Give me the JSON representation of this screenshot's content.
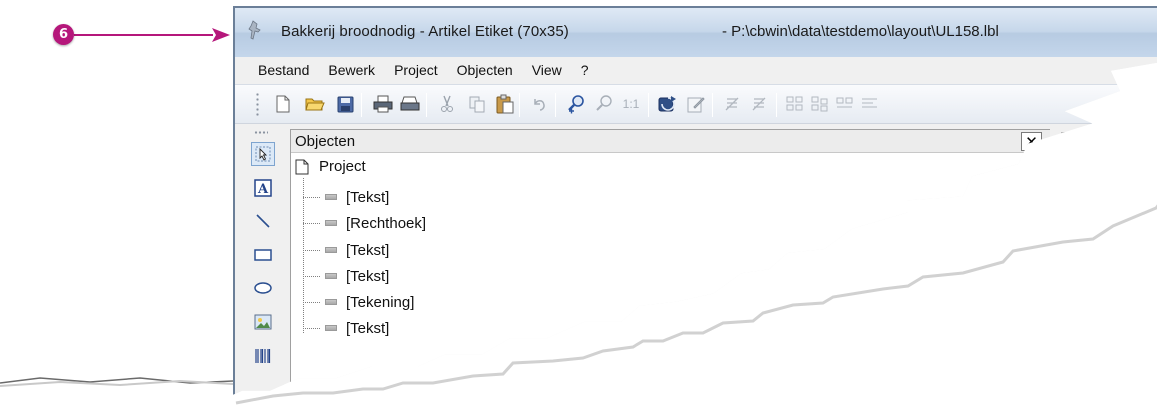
{
  "callout": {
    "number": "6",
    "color": "#b5177b"
  },
  "window": {
    "title": "Bakkerij broodnodig - Artikel Etiket (70x35)",
    "path": "- P:\\cbwin\\data\\testdemo\\layout\\UL158.lbl"
  },
  "menu": {
    "items": [
      "Bestand",
      "Bewerk",
      "Project",
      "Objecten",
      "View",
      "?"
    ]
  },
  "toolbar": {
    "buttons": [
      "new-icon",
      "open-folder-icon",
      "save-icon",
      "print-icon",
      "print-preview-icon",
      "cut-icon",
      "copy-icon",
      "paste-icon",
      "undo-icon",
      "zoom-in-icon",
      "zoom-out-icon",
      "zoom-actual-icon",
      "refresh-icon",
      "edit-properties-icon",
      "align-1-icon",
      "align-2-icon",
      "distribute-1-icon",
      "distribute-2-icon",
      "distribute-3-icon",
      "distribute-4-icon"
    ],
    "zoom_actual_label": "1:1"
  },
  "tools": [
    "select-tool-icon",
    "text-tool-icon",
    "line-tool-icon",
    "rectangle-tool-icon",
    "ellipse-tool-icon",
    "image-tool-icon",
    "barcode-tool-icon"
  ],
  "objects_panel": {
    "title": "Objecten",
    "close_label": "✕",
    "root": "Project",
    "items": [
      "[Tekst]",
      "[Rechthoek]",
      "[Tekst]",
      "[Tekst]",
      "[Tekening]",
      "[Tekst]"
    ]
  }
}
